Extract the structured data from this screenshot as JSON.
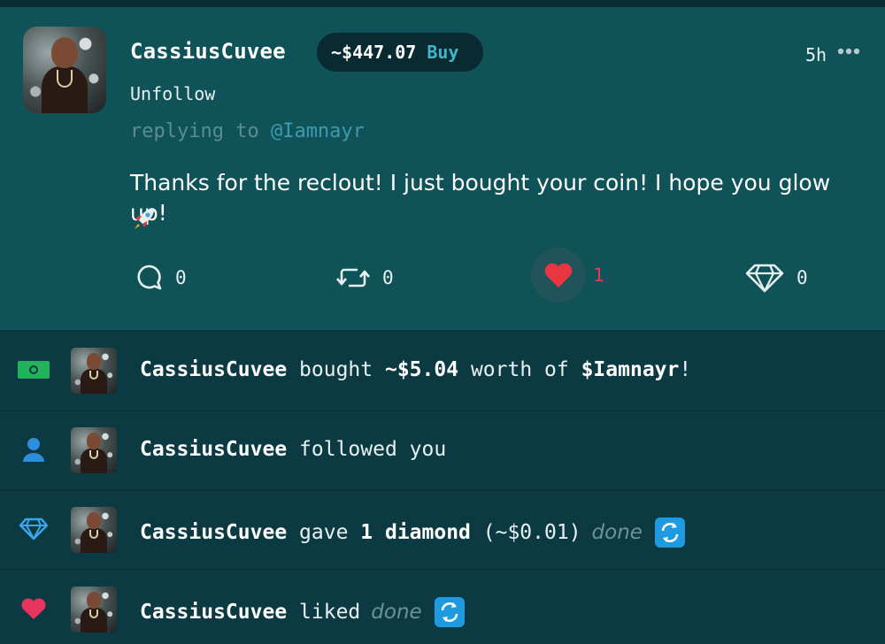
{
  "post": {
    "username": "CassiusCuvee",
    "coin_price": "~$447.07",
    "buy_label": "Buy",
    "time": "5h",
    "more_icon": "more-dots-icon",
    "unfollow_label": "Unfollow",
    "replying_prefix": "replying to",
    "replying_to": "@Iamnayr",
    "text": "Thanks for the reclout! I just bought your coin! I hope you glow up!",
    "emoji": "rocket",
    "comments": "0",
    "reposts": "0",
    "likes": "1",
    "diamonds": "0",
    "like_color": "#e8353f"
  },
  "notifications": [
    {
      "icon": "money-icon",
      "user": "CassiusCuvee",
      "verb": "bought",
      "amount": "~$5.04",
      "mid": "worth of",
      "coin": "$Iamnayr",
      "end": "!"
    },
    {
      "icon": "person-icon",
      "user": "CassiusCuvee",
      "verb": "followed you"
    },
    {
      "icon": "diamond-icon",
      "user": "CassiusCuvee",
      "verb": "gave",
      "amount": "1 diamond",
      "value": "(~$0.01)",
      "done": "done"
    },
    {
      "icon": "heart-icon",
      "user": "CassiusCuvee",
      "verb": "liked",
      "done": "done"
    }
  ],
  "colors": {
    "accent": "#3fb6c9",
    "money": "#21b35a",
    "person": "#2f8de0",
    "diamond": "#39a7ea",
    "heart": "#e8345e"
  }
}
